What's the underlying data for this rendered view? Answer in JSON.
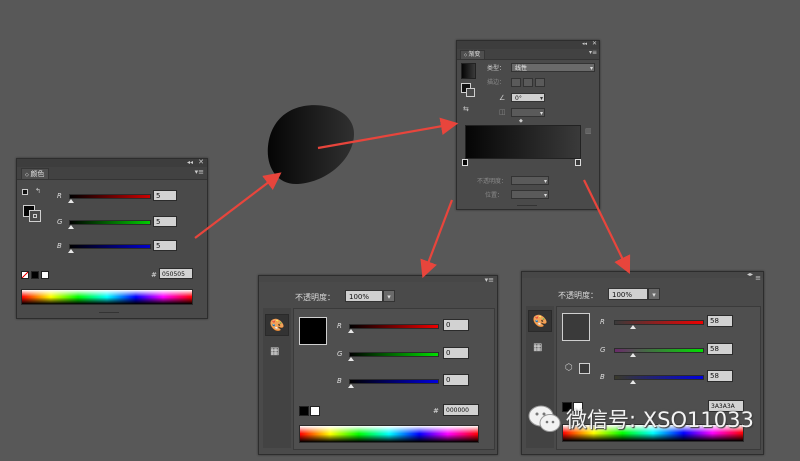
{
  "colors": {
    "background": "#585858",
    "arrow": "#e8453c",
    "panel": "#4a4a4a"
  },
  "color_panel": {
    "tab": "颜色",
    "r": {
      "label": "R",
      "value": "5"
    },
    "g": {
      "label": "G",
      "value": "5"
    },
    "b": {
      "label": "B",
      "value": "5"
    },
    "hex_prefix": "#",
    "hex": "050505",
    "collapse_icon": "collapse-arrows-icon",
    "close_icon": "close-icon",
    "menu_icon": "panel-menu-icon"
  },
  "gradient_panel": {
    "tab": "渐变",
    "type_label": "类型：",
    "type_value": "线性",
    "stroke_label": "描边：",
    "angle_value": "0°",
    "opacity_label": "不透明度：",
    "location_label": "位置："
  },
  "color_picker_a": {
    "opacity_label": "不透明度：",
    "opacity_value": "100%",
    "r": {
      "label": "R",
      "value": "0"
    },
    "g": {
      "label": "G",
      "value": "0"
    },
    "b": {
      "label": "B",
      "value": "0"
    },
    "hex_prefix": "#",
    "hex": "000000"
  },
  "color_picker_b": {
    "opacity_label": "不透明度：",
    "opacity_value": "100%",
    "r": {
      "label": "R",
      "value": "58"
    },
    "g": {
      "label": "G",
      "value": "58"
    },
    "b": {
      "label": "B",
      "value": "58"
    },
    "hex": "3A3A3A"
  },
  "watermark": {
    "text": "微信号: XSO11033",
    "icon": "wechat-icon"
  }
}
